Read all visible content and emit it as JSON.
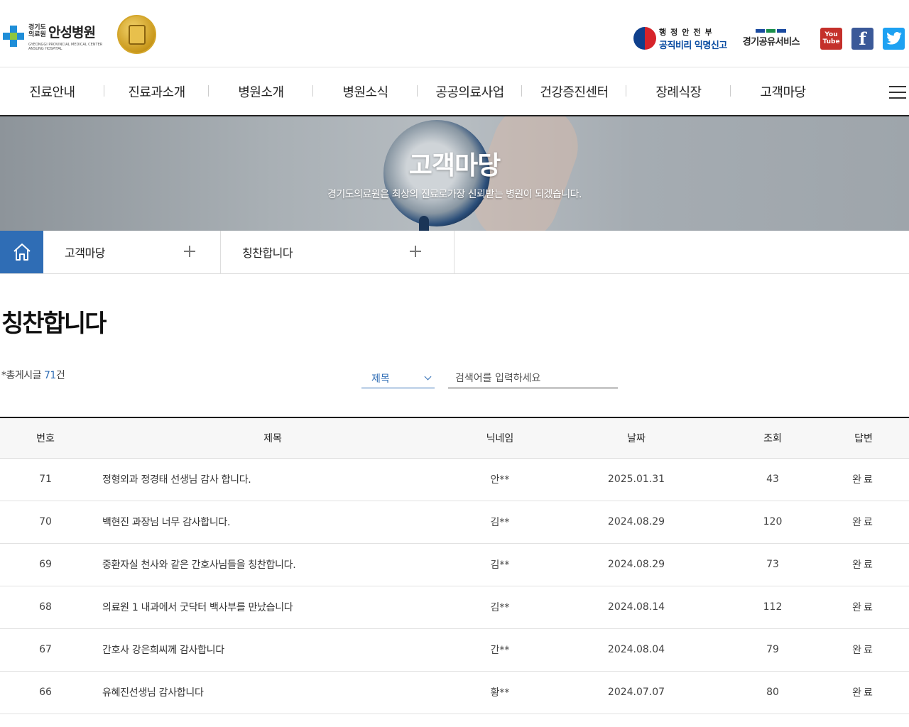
{
  "header": {
    "logo_small": "경기도 의료원",
    "logo_name": "안성병원",
    "logo_en": "GYEONGGI PROVINCIAL MEDICAL CENTER ANSUNG HOSPITAL",
    "gov_top": "행정안전부",
    "gov_bottom": "공직비리 익명신고",
    "share_text": "경기공유서비스",
    "youtube": "You Tube",
    "facebook": "f",
    "twitter": "t"
  },
  "gnb": [
    "진료안내",
    "진료과소개",
    "병원소개",
    "병원소식",
    "공공의료사업",
    "건강증진센터",
    "장례식장",
    "고객마당"
  ],
  "banner": {
    "title": "고객마당",
    "subtitle": "경기도의료원은 최상의 진료로가장 신뢰받는 병원이 되겠습니다."
  },
  "location": {
    "depth1": "고객마당",
    "depth2": "칭찬합니다"
  },
  "page": {
    "title": "칭찬합니다",
    "total_prefix": "*총게시글 ",
    "total_count": "71",
    "total_suffix": "건"
  },
  "search": {
    "select_value": "제목",
    "placeholder": "검색어를 입력하세요"
  },
  "table": {
    "headers": [
      "번호",
      "제목",
      "닉네임",
      "날짜",
      "조회",
      "답변"
    ],
    "rows": [
      {
        "no": "71",
        "subject": "정형외과 정경태 선생님 감사 합니다.",
        "nick": "안**",
        "date": "2025.01.31",
        "views": "43",
        "answer": "완료"
      },
      {
        "no": "70",
        "subject": "백현진 과장님 너무 감사합니다.",
        "nick": "김**",
        "date": "2024.08.29",
        "views": "120",
        "answer": "완료"
      },
      {
        "no": "69",
        "subject": "중환자실 천사와 같은 간호사님들을 칭찬합니다.",
        "nick": "김**",
        "date": "2024.08.29",
        "views": "73",
        "answer": "완료"
      },
      {
        "no": "68",
        "subject": "의료원 1 내과에서 굿닥터 백사부를 만났습니다",
        "nick": "김**",
        "date": "2024.08.14",
        "views": "112",
        "answer": "완료"
      },
      {
        "no": "67",
        "subject": "간호사 강은희씨께 감사합니다",
        "nick": "간**",
        "date": "2024.08.04",
        "views": "79",
        "answer": "완료"
      },
      {
        "no": "66",
        "subject": "유혜진선생님 감사합니다",
        "nick": "황**",
        "date": "2024.07.07",
        "views": "80",
        "answer": "완료"
      }
    ]
  }
}
